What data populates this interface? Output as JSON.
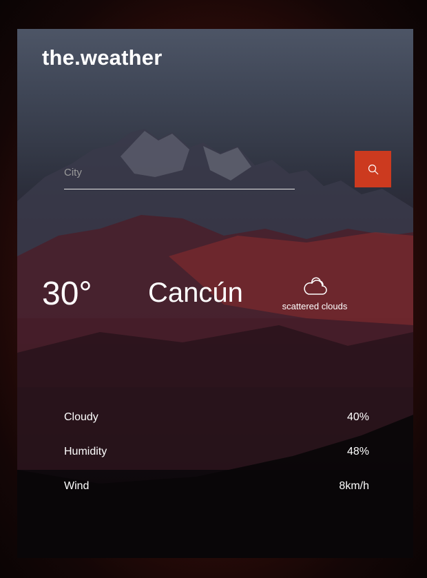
{
  "app": {
    "logo": "the.weather"
  },
  "search": {
    "placeholder": "City",
    "button_icon": "search-icon"
  },
  "current": {
    "temperature": "30°",
    "city": "Cancún",
    "condition_icon": "cloud-icon",
    "condition": "scattered clouds"
  },
  "details": [
    {
      "label": "Cloudy",
      "value": "40%"
    },
    {
      "label": "Humidity",
      "value": "48%"
    },
    {
      "label": "Wind",
      "value": "8km/h"
    }
  ],
  "colors": {
    "accent": "#cc3a1f",
    "text": "#ffffff"
  }
}
